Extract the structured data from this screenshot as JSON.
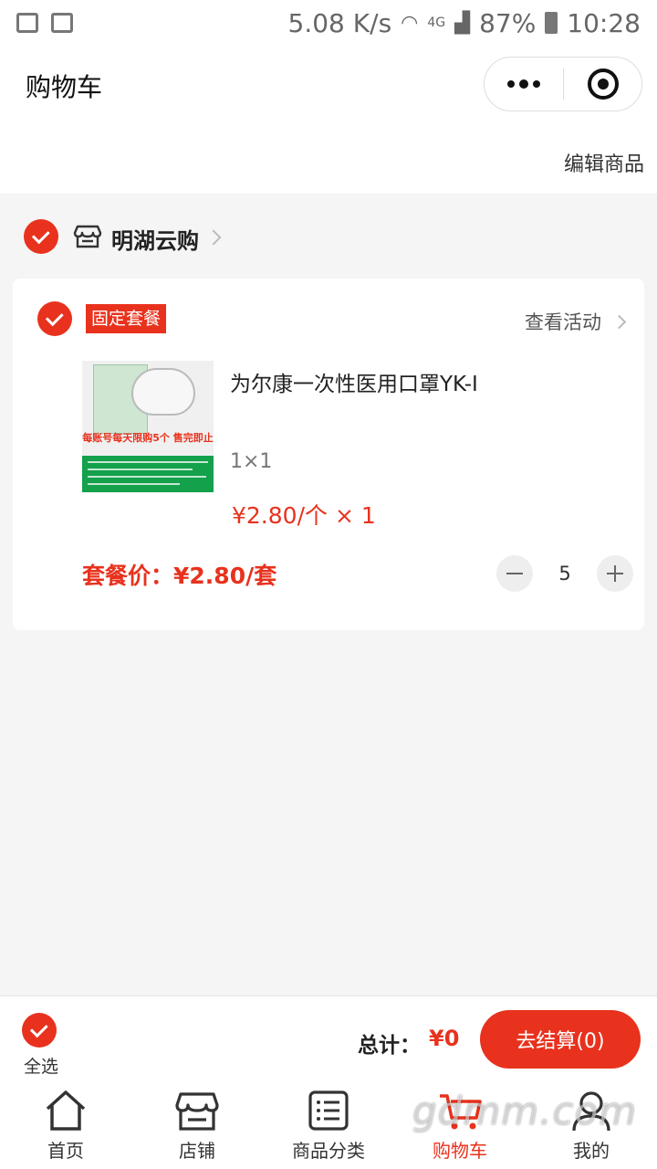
{
  "status_bar": {
    "speed": "5.08 K/s",
    "network": "4G",
    "battery": "87%",
    "time": "10:28"
  },
  "header": {
    "title": "购物车",
    "more_icon": "more-dots-icon",
    "close_icon": "target-circle-icon"
  },
  "edit_link": "编辑商品",
  "store": {
    "name": "明湖云购",
    "icon": "store-icon",
    "checked": true
  },
  "package": {
    "tag": "固定套餐",
    "activity_link": "查看活动",
    "product": {
      "name": "为尔康一次性医用口罩YK-I",
      "image_caption": "每账号每天限购5个 售完即止",
      "spec": "1×1",
      "unit_price": "¥2.80/个 × 1"
    },
    "combo_label": "套餐价：",
    "combo_price": "¥2.80/套",
    "quantity": "5"
  },
  "checkout": {
    "select_all": "全选",
    "total_label": "总计：",
    "total_value": "¥0",
    "pay_button": "去结算(0)"
  },
  "tabbar": [
    {
      "label": "首页",
      "icon": "home-icon",
      "active": false
    },
    {
      "label": "店铺",
      "icon": "store-icon",
      "active": false
    },
    {
      "label": "商品分类",
      "icon": "list-icon",
      "active": false
    },
    {
      "label": "购物车",
      "icon": "cart-icon",
      "active": true
    },
    {
      "label": "我的",
      "icon": "user-icon",
      "active": false
    }
  ],
  "watermark": "gdmm.com",
  "colors": {
    "accent": "#e8321d",
    "background": "#f5f5f5"
  }
}
